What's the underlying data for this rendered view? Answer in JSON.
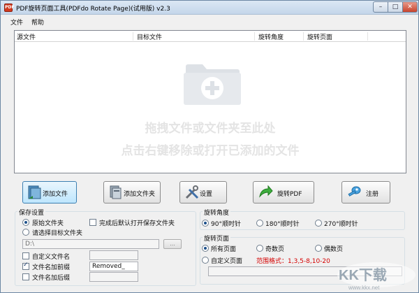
{
  "window": {
    "title": "PDF旋转页面工具(PDFdo Rotate Page)(试用版) v2.3",
    "app_icon_text": "PDF",
    "min_glyph": "–",
    "max_glyph": "□",
    "close_glyph": "✕"
  },
  "menu": {
    "items": [
      "文件",
      "帮助"
    ]
  },
  "file_list": {
    "columns": [
      "源文件",
      "目标文件",
      "旋转角度",
      "旋转页面"
    ],
    "hint_line1": "拖拽文件或文件夹至此处",
    "hint_line2": "点击右键移除或打开已添加的文件"
  },
  "toolbar": {
    "add_file": "添加文件",
    "add_folder": "添加文件夹",
    "settings": "设置",
    "rotate_pdf": "旋转PDF",
    "register": "注册"
  },
  "save_settings": {
    "title": "保存设置",
    "original_folder": "原始文件夹",
    "open_after_done": "完成后默认打开保存文件夹",
    "choose_target": "请选择目标文件夹",
    "path_value": "D:\\",
    "browse": "...",
    "custom_name": "自定义文件名",
    "add_prefix": "文件名加前缀",
    "prefix_value": "Removed_",
    "add_suffix": "文件名加后缀"
  },
  "rotate_angle": {
    "title": "旋转角度",
    "options": [
      "90°顺时针",
      "180°顺时针",
      "270°顺时针"
    ]
  },
  "rotate_pages": {
    "title": "旋转页面",
    "all_pages": "所有页面",
    "odd_pages": "奇数页",
    "even_pages": "偶数页",
    "custom_pages": "自定义页面",
    "range_hint": "范围格式：1,3,5-8,10-20"
  },
  "watermark": {
    "main": "KK下载",
    "url": "www.kkx.net"
  },
  "colors": {
    "accent_red": "#d40000",
    "title_blue": "#c4d6ea",
    "folder_gray": "#dde1e6"
  }
}
